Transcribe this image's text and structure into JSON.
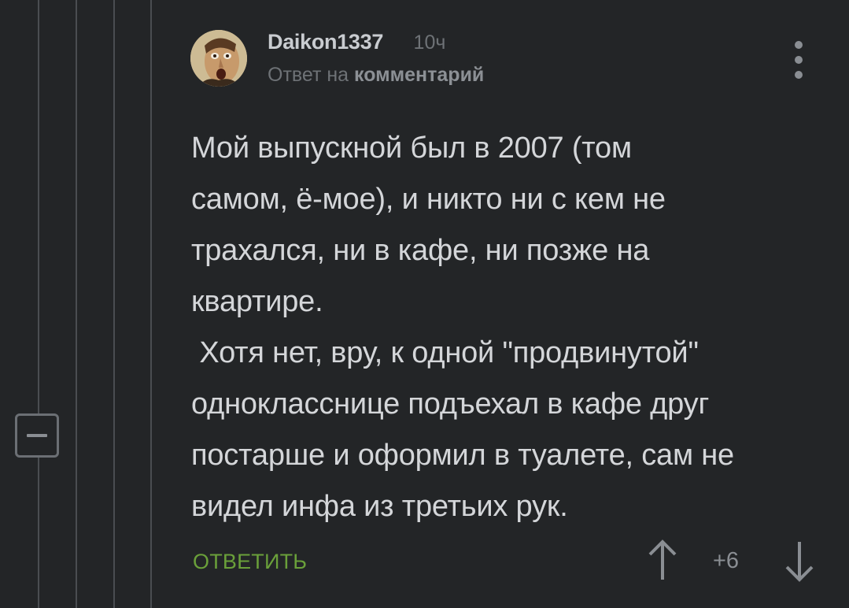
{
  "comment": {
    "author": "Daikon1337",
    "time": "10ч",
    "reply_prefix": "Ответ на",
    "reply_target": "комментарий",
    "body": "Мой выпускной был в 2007 (том\nсамом, ё-мое), и никто ни с кем не\nтрахался, ни в кафе, ни позже на\nквартире.\n Хотя нет, вру, к одной \"продвинутой\"\nоднокласснице подъехал в кафе друг\nпостарше и оформил в туалете, сам не\nвидел инфа из третьих рук.",
    "reply_label": "ОТВЕТИТЬ",
    "rating": "+6"
  },
  "icons": {
    "menu": "more-vertical-icon",
    "upvote": "arrow-up-icon",
    "downvote": "arrow-down-icon",
    "collapse": "minus-icon"
  },
  "colors": {
    "background": "#232527",
    "text": "#d4d6d9",
    "muted": "#6e7276",
    "accent_green": "#6aa03a",
    "thread_line": "#4a4d51"
  }
}
